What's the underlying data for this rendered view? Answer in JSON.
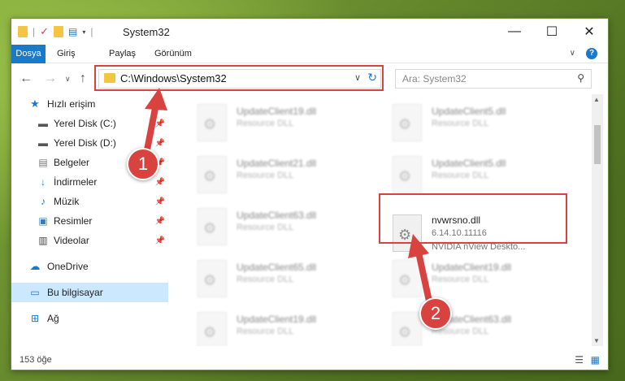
{
  "window": {
    "title": "System32"
  },
  "ribbon": {
    "tabs": [
      "Dosya",
      "Giriş",
      "Paylaş",
      "Görünüm"
    ]
  },
  "address": {
    "path": "C:\\Windows\\System32"
  },
  "search": {
    "placeholder": "Ara: System32"
  },
  "sidebar": {
    "items": [
      {
        "label": "Hızlı erişim"
      },
      {
        "label": "Yerel Disk (C:)"
      },
      {
        "label": "Yerel Disk (D:)"
      },
      {
        "label": "Belgeler"
      },
      {
        "label": "İndirmeler"
      },
      {
        "label": "Müzik"
      },
      {
        "label": "Resimler"
      },
      {
        "label": "Videolar"
      },
      {
        "label": "OneDrive"
      },
      {
        "label": "Bu bilgisayar"
      },
      {
        "label": "Ağ"
      }
    ]
  },
  "files": [
    {
      "name": "UpdateClient19.dll",
      "desc": "Resource DLL"
    },
    {
      "name": "UpdateClient5.dll",
      "desc": "Resource DLL"
    },
    {
      "name": "UpdateClient21.dll",
      "desc": "Resource DLL"
    },
    {
      "name": "UpdateClient5.dll",
      "desc": "Resource DLL"
    },
    {
      "name": "UpdateClient63.dll",
      "desc": "Resource DLL"
    },
    {
      "name": "nvwrsno.dll",
      "desc": "6.14.10.11116",
      "desc2": "NVIDIA nView Deskto..."
    },
    {
      "name": "UpdateClient65.dll",
      "desc": "Resource DLL"
    },
    {
      "name": "UpdateClient19.dll",
      "desc": "Resource DLL"
    },
    {
      "name": "UpdateClient19.dll",
      "desc": "Resource DLL"
    },
    {
      "name": "UpdateClient63.dll",
      "desc": "Resource DLL"
    }
  ],
  "status": {
    "count": "153 öğe"
  },
  "callouts": [
    "1",
    "2"
  ],
  "colors": {
    "accent": "#1979ca",
    "highlight": "#d9433f",
    "selected": "#cce8ff"
  }
}
